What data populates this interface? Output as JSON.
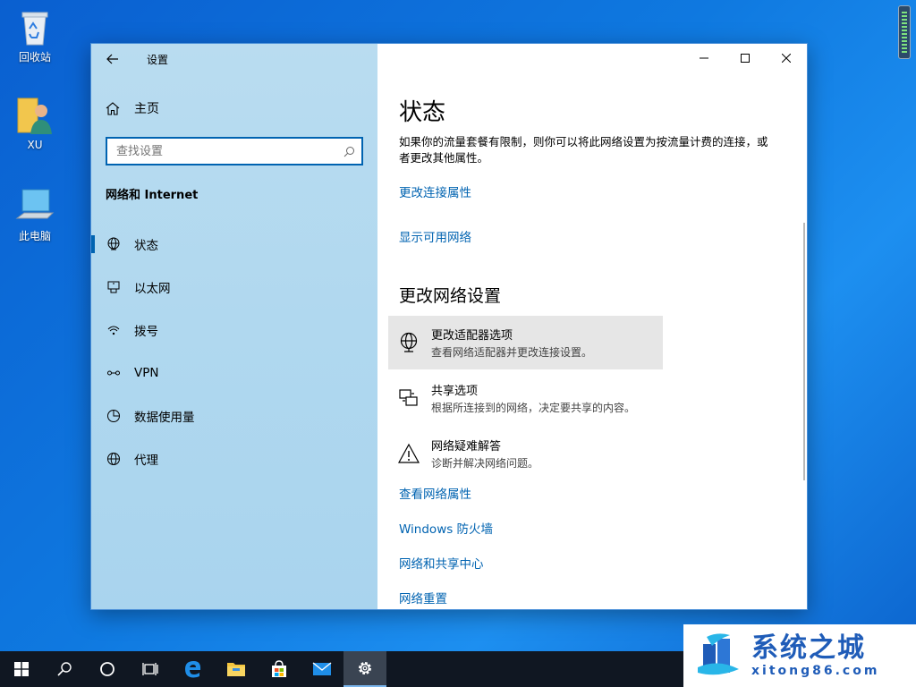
{
  "desktop": {
    "icons": [
      {
        "label": "回收站"
      },
      {
        "label": "XU"
      },
      {
        "label": "此电脑"
      }
    ]
  },
  "window": {
    "app_title": "设置",
    "home_label": "主页",
    "search_placeholder": "查找设置",
    "section_title": "网络和 Internet",
    "nav": [
      {
        "label": "状态"
      },
      {
        "label": "以太网"
      },
      {
        "label": "拨号"
      },
      {
        "label": "VPN"
      },
      {
        "label": "数据使用量"
      },
      {
        "label": "代理"
      }
    ],
    "active_nav": "状态"
  },
  "main": {
    "title": "状态",
    "intro": "如果你的流量套餐有限制，则你可以将此网络设置为按流量计费的连接，或者更改其他属性。",
    "link_change_connection": "更改连接属性",
    "link_show_networks": "显示可用网络",
    "section_title": "更改网络设置",
    "options": [
      {
        "title": "更改适配器选项",
        "desc": "查看网络适配器并更改连接设置。"
      },
      {
        "title": "共享选项",
        "desc": "根据所连接到的网络，决定要共享的内容。"
      },
      {
        "title": "网络疑难解答",
        "desc": "诊断并解决网络问题。"
      }
    ],
    "links": [
      {
        "label": "查看网络属性"
      },
      {
        "label": "Windows 防火墙"
      },
      {
        "label": "网络和共享中心"
      },
      {
        "label": "网络重置"
      }
    ]
  },
  "watermark": {
    "text": "系统之城",
    "url": "xitong86.com"
  },
  "colors": {
    "accent": "#0063b1",
    "sidebar": "#b0d8ef",
    "taskbar": "#101722"
  }
}
